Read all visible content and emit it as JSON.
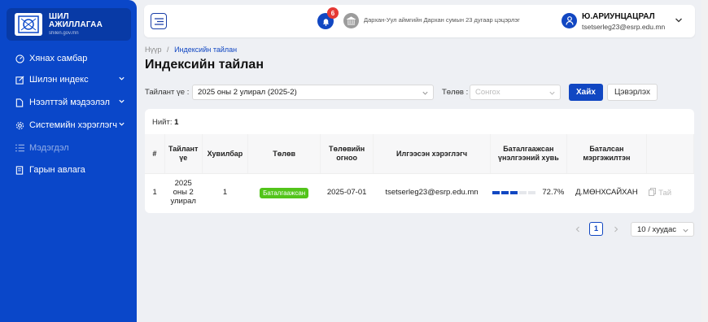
{
  "logo": {
    "line1": "ШИЛ",
    "line2": "АЖИЛЛАГАА",
    "line3": "shilen.gov.mn"
  },
  "sidebar": {
    "items": [
      {
        "label": "Хянах самбар",
        "icon": "dashboard-icon"
      },
      {
        "label": "Шилэн индекс",
        "icon": "edit-icon",
        "expandable": true
      },
      {
        "label": "Нээлттэй мэдээлэл",
        "icon": "document-icon",
        "expandable": true
      },
      {
        "label": "Системийн хэрэглэгч",
        "icon": "gear-icon",
        "expandable": true
      },
      {
        "label": "Мэдэгдэл",
        "icon": "list-icon",
        "disabled": true
      },
      {
        "label": "Гарын авлага",
        "icon": "book-icon"
      }
    ]
  },
  "topbar": {
    "notification_count": "6",
    "organization": "Дархан-Уул аймгийн Дархан сумын 23 дугаар цэцэрлэг",
    "user_name": "Ю.АРИУНЦАЦРАЛ",
    "user_email": "tsetserleg23@esrp.edu.mn"
  },
  "breadcrumb": {
    "home": "Нүүр",
    "separator": "/",
    "current": "Индексийн тайлан"
  },
  "page_title": "Индексийн тайлан",
  "filters": {
    "period_label": "Тайлант үе :",
    "period_value": "2025 оны 2 улирал (2025-2)",
    "status_label": "Төлөв :",
    "status_placeholder": "Сонгох",
    "search_button": "Хайх",
    "clear_button": "Цэвэрлэх"
  },
  "table": {
    "total_label": "Нийт:",
    "total_value": "1",
    "headers": [
      "#",
      "Тайлант үе",
      "Хувилбар",
      "Төлөв",
      "Төлөвийн огноо",
      "Илгээсэн хэрэглэгч",
      "Баталгаажсан үнэлгээний хувь",
      "Баталсан мэргэжилтэн",
      ""
    ],
    "rows": [
      {
        "index": "1",
        "period": "2025 оны 2 улирал",
        "version": "1",
        "status": "Баталгаажсан",
        "status_date": "2025-07-01",
        "sender": "tsetserleg23@esrp.edu.mn",
        "progress_percent": 72.7,
        "progress_label": "72.7%",
        "approver": "Д.МӨНХСАЙХАН",
        "action": "Тай"
      }
    ]
  },
  "pagination": {
    "current_page": "1",
    "page_size": "10 / хуудас"
  },
  "colors": {
    "primary": "#1147c2",
    "sidebar": "#0a47c9",
    "success": "#52c41a",
    "badge": "#e53935"
  }
}
